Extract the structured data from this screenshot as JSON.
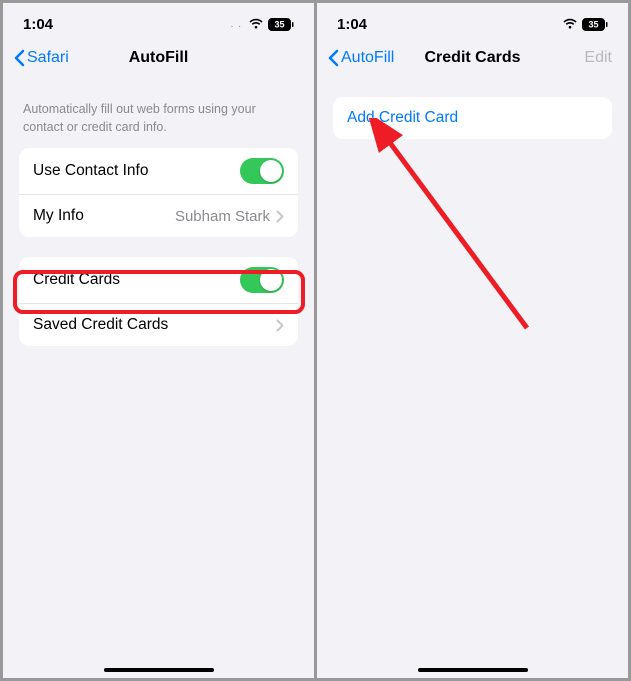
{
  "left": {
    "time": "1:04",
    "battery": "35",
    "back_label": "Safari",
    "title": "AutoFill",
    "hint": "Automatically fill out web forms using your contact or credit card info.",
    "group1": {
      "use_contact_label": "Use Contact Info",
      "my_info_label": "My Info",
      "my_info_value": "Subham Stark"
    },
    "group2": {
      "credit_cards_label": "Credit Cards",
      "saved_label": "Saved Credit Cards"
    }
  },
  "right": {
    "time": "1:04",
    "battery": "35",
    "back_label": "AutoFill",
    "title": "Credit Cards",
    "edit_label": "Edit",
    "add_card_label": "Add Credit Card"
  }
}
